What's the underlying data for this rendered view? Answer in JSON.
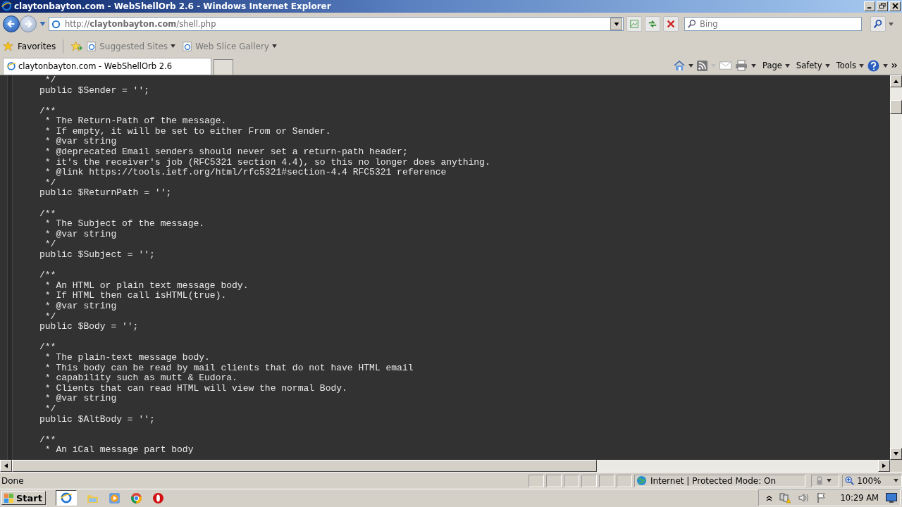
{
  "window": {
    "title": "claytonbayton.com - WebShellOrb 2.6 - Windows Internet Explorer"
  },
  "address_bar": {
    "url": "http://**claytonbayton.com**/shell.php"
  },
  "search": {
    "placeholder": "Bing"
  },
  "favorites_bar": {
    "label": "Favorites",
    "links": [
      "Suggested Sites",
      "Web Slice Gallery"
    ]
  },
  "tabs": [
    {
      "label": "claytonbayton.com - WebShellOrb 2.6",
      "selected": true
    }
  ],
  "command_bar": [
    "Page",
    "Safety",
    "Tools"
  ],
  "code": {
    "blocks": [
      [
        " */",
        "public $Sender = '';"
      ],
      [
        "/**",
        " * The Return-Path of the message.",
        " * If empty, it will be set to either From or Sender.",
        " * @var string",
        " * @deprecated Email senders should never set a return-path header;",
        " * it's the receiver's job (RFC5321 section 4.4), so this no longer does anything.",
        " * @link https://tools.ietf.org/html/rfc5321#section-4.4 RFC5321 reference",
        " */",
        "public $ReturnPath = '';"
      ],
      [
        "/**",
        " * The Subject of the message.",
        " * @var string",
        " */",
        "public $Subject = '';"
      ],
      [
        "/**",
        " * An HTML or plain text message body.",
        " * If HTML then call isHTML(true).",
        " * @var string",
        " */",
        "public $Body = '';"
      ],
      [
        "/**",
        " * The plain-text message body.",
        " * This body can be read by mail clients that do not have HTML email",
        " * capability such as mutt & Eudora.",
        " * Clients that can read HTML will view the normal Body.",
        " * @var string",
        " */",
        "public $AltBody = '';"
      ],
      [
        "/**",
        " * An iCal message part body"
      ]
    ]
  },
  "status_bar": {
    "text": "Done",
    "zone": "Internet | Protected Mode: On",
    "zoom": "100%"
  },
  "taskbar": {
    "start": "Start",
    "clock": "10:29 AM"
  }
}
